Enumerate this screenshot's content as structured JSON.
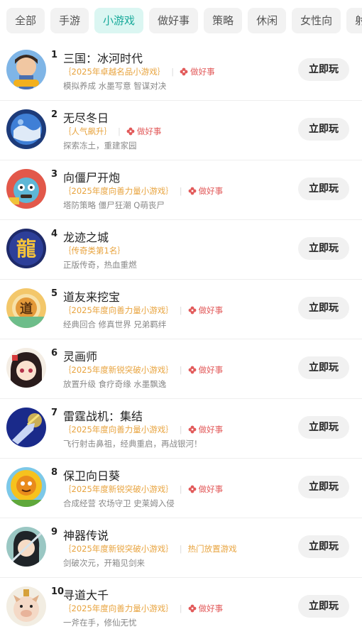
{
  "tabs": [
    {
      "label": "全部",
      "active": false
    },
    {
      "label": "手游",
      "active": false
    },
    {
      "label": "小游戏",
      "active": true
    },
    {
      "label": "做好事",
      "active": false
    },
    {
      "label": "策略",
      "active": false
    },
    {
      "label": "休闲",
      "active": false
    },
    {
      "label": "女性向",
      "active": false
    },
    {
      "label": "射",
      "active": false
    }
  ],
  "play_label": "立即玩",
  "good_label": "做好事",
  "colors": {
    "accent": "#17a99a",
    "award": "#e8a33d",
    "good": "#e25a5a"
  },
  "games": [
    {
      "rank": "1",
      "title": "三国：冰河时代",
      "award": "2025年卓越名品小游戏",
      "badge": "做好事",
      "badge_type": "good",
      "desc": "模拟养成  水墨写意  智谋对决",
      "icon": "three-kingdoms-icon"
    },
    {
      "rank": "2",
      "title": "无尽冬日",
      "award": "人气飙升",
      "badge": "做好事",
      "badge_type": "good",
      "desc": "探索冻土，重建家园",
      "icon": "winter-globe-icon"
    },
    {
      "rank": "3",
      "title": "向僵尸开炮",
      "award": "2025年度向善力量小游戏",
      "badge": "做好事",
      "badge_type": "good",
      "desc": "塔防策略  僵尸狂潮  Q萌丧尸",
      "icon": "zombie-icon"
    },
    {
      "rank": "4",
      "title": "龙迹之城",
      "award": "传奇类第1名",
      "badge": "",
      "badge_type": "none",
      "desc": "正版传奇，热血重燃",
      "icon": "dragon-icon"
    },
    {
      "rank": "5",
      "title": "道友来挖宝",
      "award": "2025年度向善力量小游戏",
      "badge": "做好事",
      "badge_type": "good",
      "desc": "经典回合  修真世界  兄弟羁绊",
      "icon": "dao-icon"
    },
    {
      "rank": "6",
      "title": "灵画师",
      "award": "2025年度新锐突破小游戏",
      "badge": "做好事",
      "badge_type": "good",
      "desc": "放置升级  食疗奇缘  水墨飘逸",
      "icon": "painter-girl-icon"
    },
    {
      "rank": "7",
      "title": "雷霆战机：集结",
      "award": "2025年度向善力量小游戏",
      "badge": "做好事",
      "badge_type": "good",
      "desc": "飞行射击鼻祖，经典重启，再战银河！",
      "icon": "fighter-jet-icon"
    },
    {
      "rank": "8",
      "title": "保卫向日葵",
      "award": "2025年度新锐突破小游戏",
      "badge": "做好事",
      "badge_type": "good",
      "desc": "合成经营  农场守卫  史莱姆入侵",
      "icon": "sunflower-icon"
    },
    {
      "rank": "9",
      "title": "神器传说",
      "award": "2025年度新锐突破小游戏",
      "badge": "热门放置游戏",
      "badge_type": "hot",
      "desc": "剑破次元，开箱见剑来",
      "icon": "swordsman-icon"
    },
    {
      "rank": "10",
      "title": "寻道大千",
      "award": "2025年度向善力量小游戏",
      "badge": "做好事",
      "badge_type": "good",
      "desc": "一斧在手，修仙无忧",
      "icon": "pig-icon"
    }
  ]
}
